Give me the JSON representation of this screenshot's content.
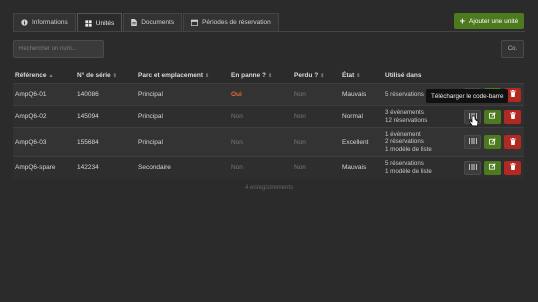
{
  "tabs": [
    {
      "label": "Informations",
      "icon": "info-icon",
      "active": false
    },
    {
      "label": "Unités",
      "icon": "grid-icon",
      "active": true
    },
    {
      "label": "Documents",
      "icon": "document-icon",
      "active": false
    },
    {
      "label": "Périodes de réservation",
      "icon": "calendar-icon",
      "active": false
    }
  ],
  "add_button": {
    "label": "Ajouter une unité"
  },
  "search": {
    "placeholder": "Rechercher un num..."
  },
  "columns_button": {
    "label": "Co."
  },
  "table": {
    "headers": [
      "Référence",
      "N° de série",
      "Parc et emplacement",
      "En panne ?",
      "Perdu ?",
      "État",
      "Utilisé dans"
    ],
    "rows": [
      {
        "reference": "AmpQ6-01",
        "serial": "140086",
        "park": "Principal",
        "broken": "Oui",
        "lost": "Non",
        "state": "Mauvais",
        "usage": [
          "5 réservations"
        ]
      },
      {
        "reference": "AmpQ6-02",
        "serial": "145094",
        "park": "Principal",
        "broken": "Non",
        "lost": "Non",
        "state": "Normal",
        "usage": [
          "3 événements",
          "12 réservations"
        ]
      },
      {
        "reference": "AmpQ6-03",
        "serial": "155684",
        "park": "Principal",
        "broken": "Non",
        "lost": "Non",
        "state": "Excellent",
        "usage": [
          "1 événement",
          "2 réservations",
          "1 modèle de liste"
        ]
      },
      {
        "reference": "AmpQ6-spare",
        "serial": "142234",
        "park": "Secondaire",
        "broken": "Non",
        "lost": "Non",
        "state": "Mauvais",
        "usage": [
          "5 réservations",
          "1 modèle de liste"
        ]
      }
    ]
  },
  "footer": {
    "count_text": "4 enregistrements"
  },
  "tooltip": {
    "text": "Télécharger le code-barre"
  },
  "colors": {
    "background": "#2b2b2b",
    "green": "#4e7a1f",
    "red": "#b02a23",
    "danger_text": "#e06a3b"
  }
}
